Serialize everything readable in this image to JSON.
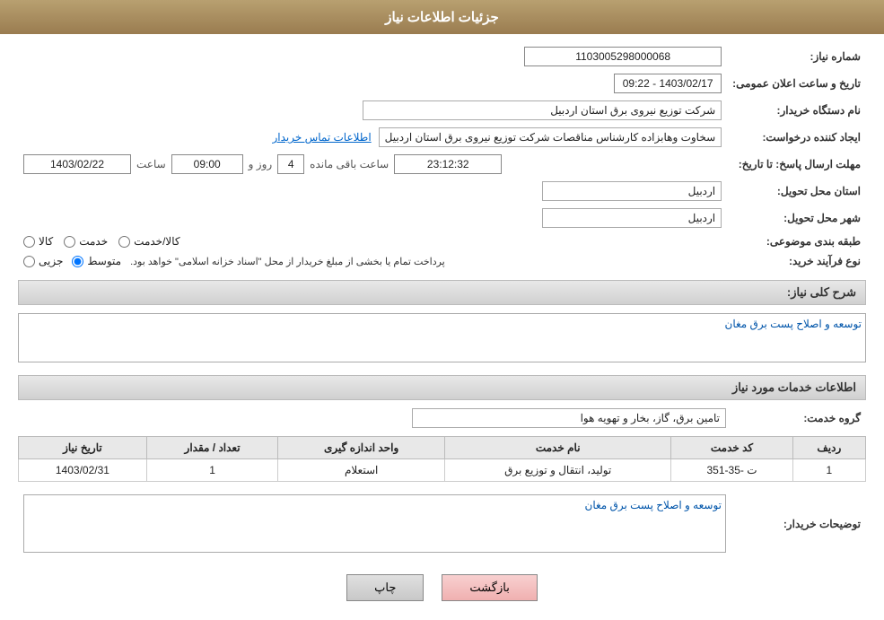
{
  "header": {
    "title": "جزئیات اطلاعات نیاز"
  },
  "fields": {
    "need_number_label": "شماره نیاز:",
    "need_number_value": "1103005298000068",
    "buyer_org_label": "نام دستگاه خریدار:",
    "buyer_org_value": "شرکت توزیع نیروی برق استان اردبیل",
    "creator_label": "ایجاد کننده درخواست:",
    "creator_value": "سخاوت وهابزاده کارشناس مناقصات شرکت توزیع نیروی برق استان اردبیل",
    "contact_link": "اطلاعات تماس خریدار",
    "announce_date_label": "تاریخ و ساعت اعلان عمومی:",
    "announce_date_value": "1403/02/17 - 09:22",
    "deadline_label": "مهلت ارسال پاسخ: تا تاریخ:",
    "deadline_date": "1403/02/22",
    "deadline_time_label": "ساعت",
    "deadline_time": "09:00",
    "deadline_day_label": "روز و",
    "deadline_days": "4",
    "deadline_remaining_label": "ساعت باقی مانده",
    "deadline_remaining": "23:12:32",
    "province_label": "استان محل تحویل:",
    "province_value": "اردبیل",
    "city_label": "شهر محل تحویل:",
    "city_value": "اردبیل",
    "category_label": "طبقه بندی موضوعی:",
    "category_options": [
      {
        "label": "کالا",
        "name": "category",
        "value": "kala"
      },
      {
        "label": "خدمت",
        "name": "category",
        "value": "khedmat"
      },
      {
        "label": "کالا/خدمت",
        "name": "category",
        "value": "kala_khedmat"
      }
    ],
    "process_label": "نوع فرآیند خرید:",
    "process_options": [
      {
        "label": "جزیی",
        "name": "process",
        "value": "jozi"
      },
      {
        "label": "متوسط",
        "name": "process",
        "value": "motavaset"
      }
    ],
    "process_desc": "پرداخت تمام یا بخشی از مبلغ خریدار از محل \"اسناد خزانه اسلامی\" خواهد بود.",
    "description_label": "شرح کلی نیاز:",
    "description_value": "توسعه و اصلاح پست برق مغان",
    "services_section": "اطلاعات خدمات مورد نیاز",
    "service_group_label": "گروه خدمت:",
    "service_group_value": "تامین برق، گاز، بخار و تهویه هوا",
    "table": {
      "headers": [
        "ردیف",
        "کد خدمت",
        "نام خدمت",
        "واحد اندازه گیری",
        "تعداد / مقدار",
        "تاریخ نیاز"
      ],
      "rows": [
        {
          "row_num": "1",
          "service_code": "ت -35-351",
          "service_name": "تولید، انتقال و توزیع برق",
          "unit": "استعلام",
          "quantity": "1",
          "date": "1403/02/31"
        }
      ]
    },
    "buyer_desc_label": "توضیحات خریدار:",
    "buyer_desc_value": "توسعه و اصلاح پست برق مغان"
  },
  "buttons": {
    "print": "چاپ",
    "back": "بازگشت"
  }
}
